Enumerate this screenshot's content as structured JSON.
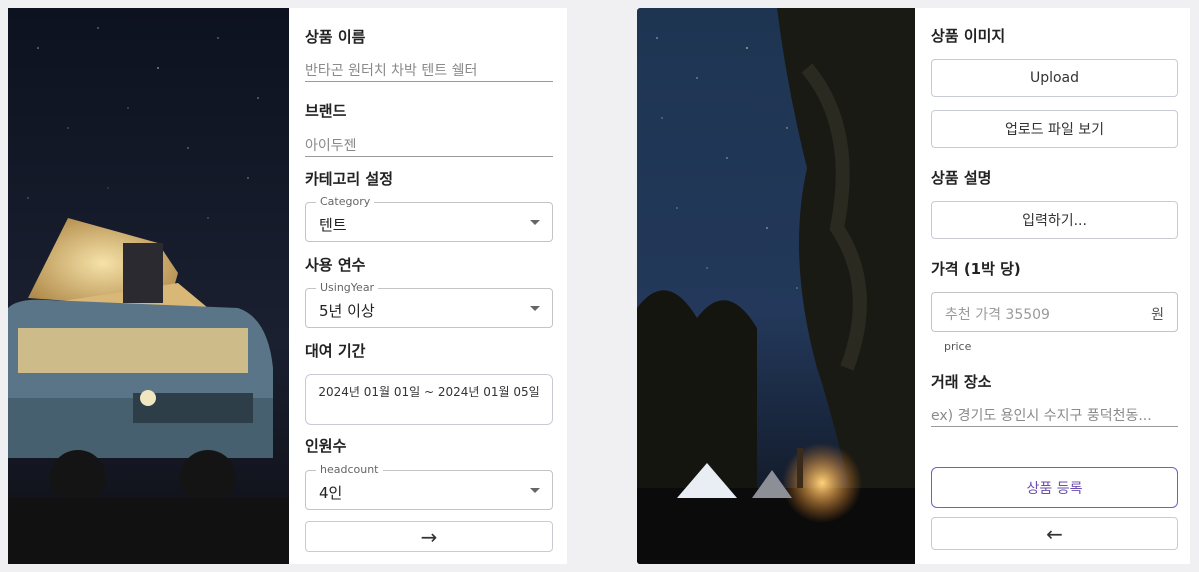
{
  "left": {
    "product_name": {
      "label": "상품 이름",
      "value": "반타곤 원터치 차박 텐트 쉘터"
    },
    "brand": {
      "label": "브랜드",
      "value": "아이두젠"
    },
    "category": {
      "label": "카테고리 설정",
      "legend": "Category",
      "value": "텐트"
    },
    "using_year": {
      "label": "사용 연수",
      "legend": "UsingYear",
      "value": "5년 이상"
    },
    "rental_period": {
      "label": "대여 기간",
      "value": "2024년 01월 01일 ~ 2024년 01월 05일"
    },
    "headcount": {
      "label": "인원수",
      "legend": "headcount",
      "value": "4인"
    },
    "next_button": "→"
  },
  "right": {
    "product_image": {
      "label": "상품 이미지",
      "upload_label": "Upload",
      "view_label": "업로드 파일 보기"
    },
    "description": {
      "label": "상품 설명",
      "button_label": "입력하기..."
    },
    "price": {
      "label": "가격 (1박 당)",
      "placeholder": "추천 가격 35509",
      "unit": "원",
      "helper": "price"
    },
    "location": {
      "label": "거래 장소",
      "placeholder": "ex) 경기도 용인시 수지구 풍덕천동..."
    },
    "submit_label": "상품 등록",
    "back_button": "←"
  },
  "colors": {
    "accent": "#7c5ac8",
    "border": "#c8ccd2",
    "page_bg": "#f0f0f2"
  }
}
